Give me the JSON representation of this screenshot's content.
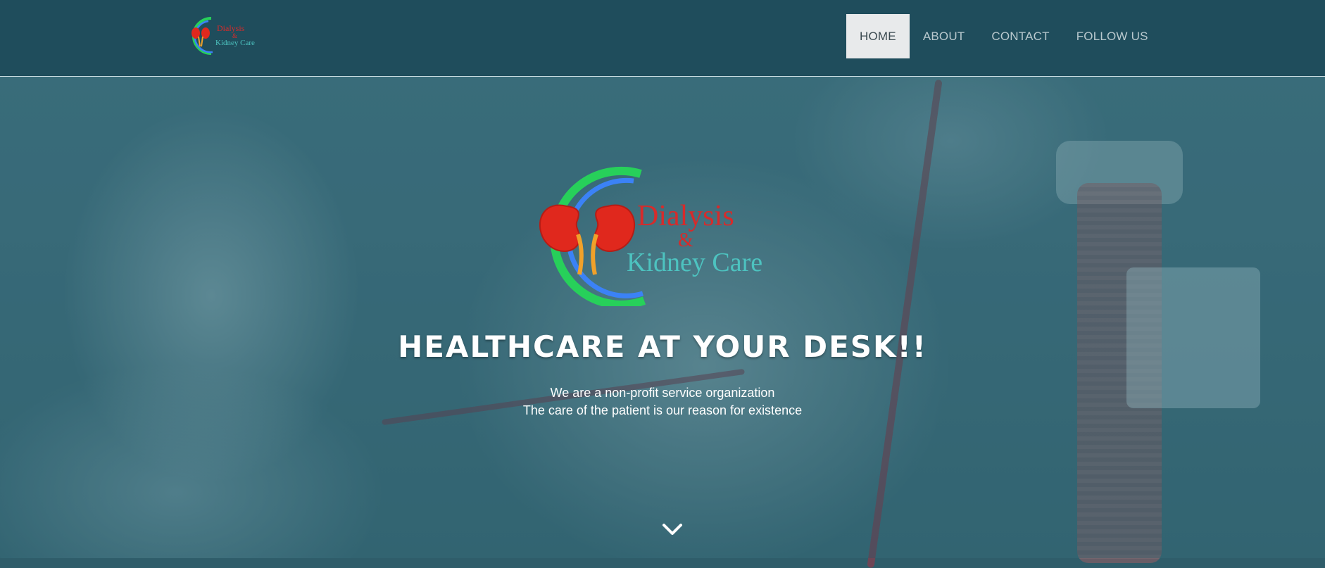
{
  "brand": {
    "logo_line1": "Dialysis",
    "logo_amp": "&",
    "logo_line2": "Kidney Care",
    "colors": {
      "ring_green": "#27d05a",
      "ring_blue": "#3b82f6",
      "kidney_red": "#e0281d",
      "text_red": "#d62b2b",
      "text_teal": "#4dc3c0"
    }
  },
  "nav": {
    "items": [
      {
        "label": "HOME",
        "active": true
      },
      {
        "label": "ABOUT",
        "active": false
      },
      {
        "label": "CONTACT",
        "active": false
      },
      {
        "label": "FOLLOW US",
        "active": false
      }
    ]
  },
  "hero": {
    "headline": "HEALTHCARE AT YOUR DESK!!",
    "tagline_line1": "We are a non-profit service organization",
    "tagline_line2": "The care of the patient is our reason for existence",
    "scroll_icon": "chevron-down-icon"
  },
  "colors": {
    "header_bg": "#1f4d5c",
    "active_nav_bg": "#e8eaeb",
    "nav_text": "#b9c9ce"
  }
}
